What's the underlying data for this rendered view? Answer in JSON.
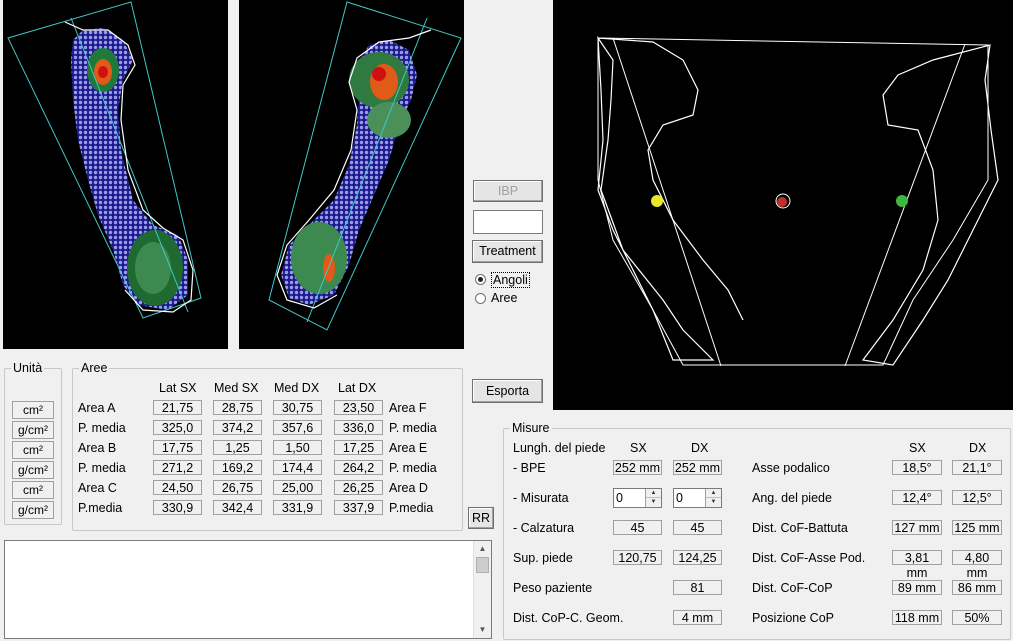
{
  "buttons": {
    "ibp": "IBP",
    "treatment": "Treatment",
    "esporta": "Esporta",
    "rr": "RR"
  },
  "options": {
    "angoli": "Angoli",
    "aree": "Aree",
    "selected": "Angoli"
  },
  "unita": {
    "title": "Unità",
    "units": [
      "cm²",
      "g/cm²",
      "cm²",
      "g/cm²",
      "cm²",
      "g/cm²"
    ]
  },
  "aree": {
    "title": "Aree",
    "headers": [
      "Lat SX",
      "Med SX",
      "Med DX",
      "Lat DX"
    ],
    "rows": [
      {
        "left": "Area A",
        "values": [
          "21,75",
          "28,75",
          "30,75",
          "23,50"
        ],
        "right": "Area F"
      },
      {
        "left": "P. media",
        "values": [
          "325,0",
          "374,2",
          "357,6",
          "336,0"
        ],
        "right": "P. media"
      },
      {
        "left": "Area B",
        "values": [
          "17,75",
          "1,25",
          "1,50",
          "17,25"
        ],
        "right": "Area E"
      },
      {
        "left": "P. media",
        "values": [
          "271,2",
          "169,2",
          "174,4",
          "264,2"
        ],
        "right": "P. media"
      },
      {
        "left": "Area C",
        "values": [
          "24,50",
          "26,75",
          "25,00",
          "26,25"
        ],
        "right": "Area D"
      },
      {
        "left": "P.media",
        "values": [
          "330,9",
          "342,4",
          "331,9",
          "337,9"
        ],
        "right": "P.media"
      }
    ]
  },
  "misure": {
    "title": "Misure",
    "left_header": {
      "label": "Lungh. del piede",
      "sx": "SX",
      "dx": "DX"
    },
    "bpe": {
      "label": "- BPE",
      "sx": "252 mm",
      "dx": "252 mm"
    },
    "misurata": {
      "label": "- Misurata",
      "sx": "0",
      "dx": "0"
    },
    "calzatura": {
      "label": "- Calzatura",
      "sx": "45",
      "dx": "45"
    },
    "sup_piede": {
      "label": "Sup. piede",
      "sx": "120,75",
      "dx": "124,25"
    },
    "peso": {
      "label": "Peso paziente",
      "value": "81"
    },
    "dist_cop": {
      "label": "Dist. CoP-C. Geom.",
      "value": "4 mm"
    },
    "right_header": {
      "sx": "SX",
      "dx": "DX"
    },
    "right_rows": [
      {
        "label": "Asse podalico",
        "sx": "18,5°",
        "dx": "21,1°"
      },
      {
        "label": "Ang. del piede",
        "sx": "12,4°",
        "dx": "12,5°"
      },
      {
        "label": "Dist. CoF-Battuta",
        "sx": "127 mm",
        "dx": "125 mm"
      },
      {
        "label": "Dist. CoF-Asse Pod.",
        "sx": "3,81 mm",
        "dx": "4,80 mm"
      },
      {
        "label": "Dist. CoF-CoP",
        "sx": "89 mm",
        "dx": "86 mm"
      },
      {
        "label": "Posizione CoP",
        "sx": "118 mm",
        "dx": "50%"
      }
    ]
  },
  "colors": {
    "cop_left": "#e8e82a",
    "cop_center": "#c0302a",
    "cop_right": "#3cb83c",
    "outline": "#ffffff",
    "axis_line": "#40c8c8"
  }
}
